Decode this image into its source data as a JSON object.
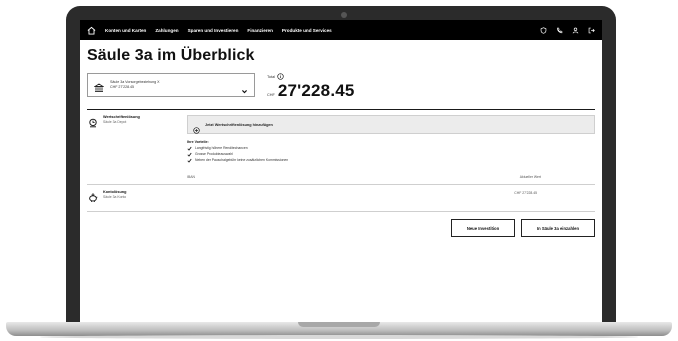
{
  "nav": {
    "items": [
      "Konten und Karten",
      "Zahlungen",
      "Sparen und Investieren",
      "Finanzieren",
      "Produkte und Services"
    ]
  },
  "page": {
    "title": "Säule 3a im Überblick"
  },
  "account_selector": {
    "name": "Säule 3a Vorsorgebeziehung X",
    "balance": "CHF 27'228.45"
  },
  "total": {
    "label": "Total",
    "currency": "CHF",
    "amount": "27'228.45"
  },
  "portfolio": {
    "title": "Wertschriftenlösung",
    "subtitle": "Säule 3a Depot",
    "add_label": "Jetzt Wertschriftenlösung hinzufügen",
    "benefits_title": "Ihre Vorteile:",
    "benefits": [
      "Langfristig höhere Renditechancen",
      "Grosse Produkteauswahl",
      "Neben der Pauschalgebühr keine zusätzlichen Kommissionen"
    ]
  },
  "table": {
    "col_iban": "IBAN",
    "col_value": "Aktueller Wert"
  },
  "account": {
    "title": "Kontolösung",
    "subtitle": "Säule 3a Konto",
    "value": "CHF 27'228.45"
  },
  "actions": {
    "new_investment": "Neue Investition",
    "deposit": "In Säule 3a einzahlen"
  },
  "colors": {
    "nav_bg": "#000000",
    "accent": "#111111",
    "panel_bg": "#ececec"
  }
}
